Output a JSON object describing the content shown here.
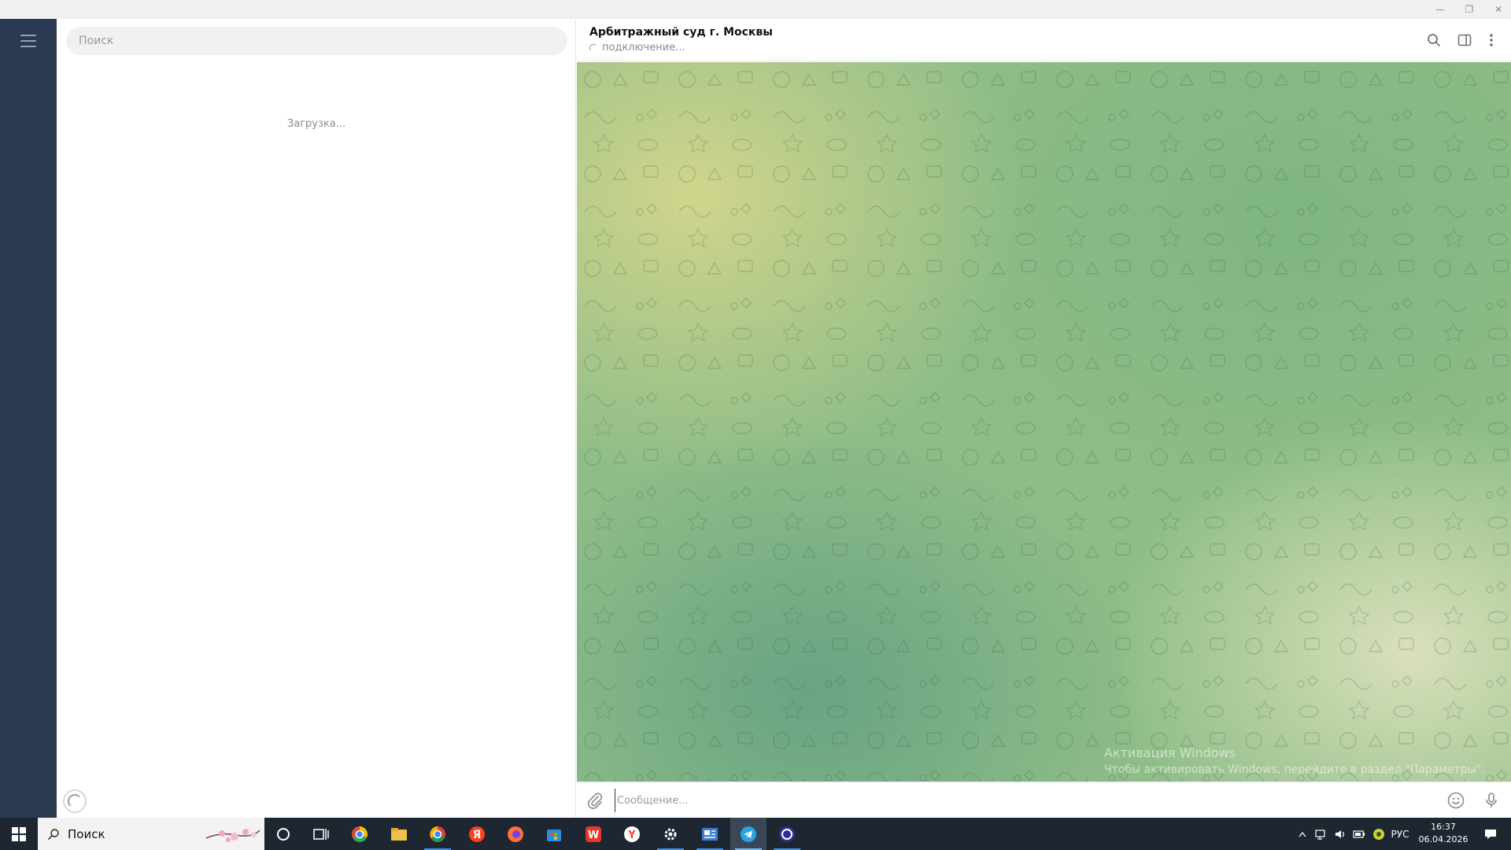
{
  "window": {
    "minimize_glyph": "—",
    "maximize_glyph": "❐",
    "close_glyph": "✕"
  },
  "sidebar": {
    "menu_icon": "hamburger-menu-icon"
  },
  "chat_list": {
    "search_placeholder": "Поиск",
    "loading_text": "Загрузка..."
  },
  "chat": {
    "title": "Арбитражный суд г. Москвы",
    "status": "подключение..."
  },
  "background_overlay": {
    "activate_title": "Активация Windows",
    "activate_hint": "Чтобы активировать Windows, перейдите в раздел \"Параметры\"."
  },
  "composer": {
    "placeholder": "Сообщение..."
  },
  "taskbar": {
    "search_label": "Поиск",
    "apps": [
      {
        "name": "cortana-icon"
      },
      {
        "name": "task-view-icon"
      },
      {
        "name": "chrome-like-icon"
      },
      {
        "name": "file-explorer-icon"
      },
      {
        "name": "chrome-icon"
      },
      {
        "name": "yandex-icon"
      },
      {
        "name": "firefox-icon"
      },
      {
        "name": "store-icon"
      },
      {
        "name": "wps-office-icon"
      },
      {
        "name": "yandex-browser-icon"
      },
      {
        "name": "settings-icon"
      },
      {
        "name": "news-app-icon"
      },
      {
        "name": "telegram-icon"
      },
      {
        "name": "other-app-icon"
      }
    ],
    "tray": {
      "language": "РУС",
      "time": "16:37",
      "date": "06.04.2026"
    }
  },
  "colors": {
    "rail": "#2a3a50",
    "taskbar": "#1d2631",
    "telegram_blue": "#2aa3e0",
    "chat_bg_green": "#8fbd88"
  }
}
